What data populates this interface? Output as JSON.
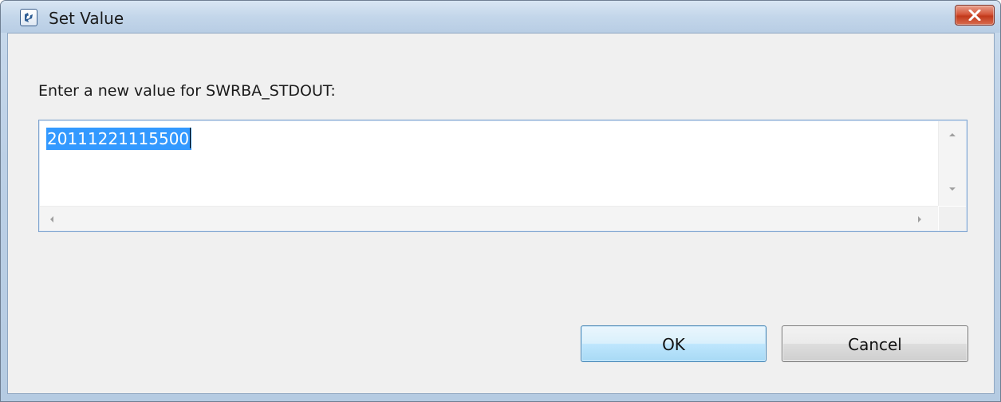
{
  "window": {
    "title": "Set Value",
    "close_icon": "close-icon",
    "app_icon": "app-icon"
  },
  "dialog": {
    "prompt": "Enter a new value for SWRBA_STDOUT:",
    "value": "20111221115500",
    "value_selected": true
  },
  "buttons": {
    "ok_label": "OK",
    "cancel_label": "Cancel"
  },
  "colors": {
    "selection": "#3399ff",
    "close_button": "#c2391b",
    "default_button_border": "#3c7fb1"
  }
}
